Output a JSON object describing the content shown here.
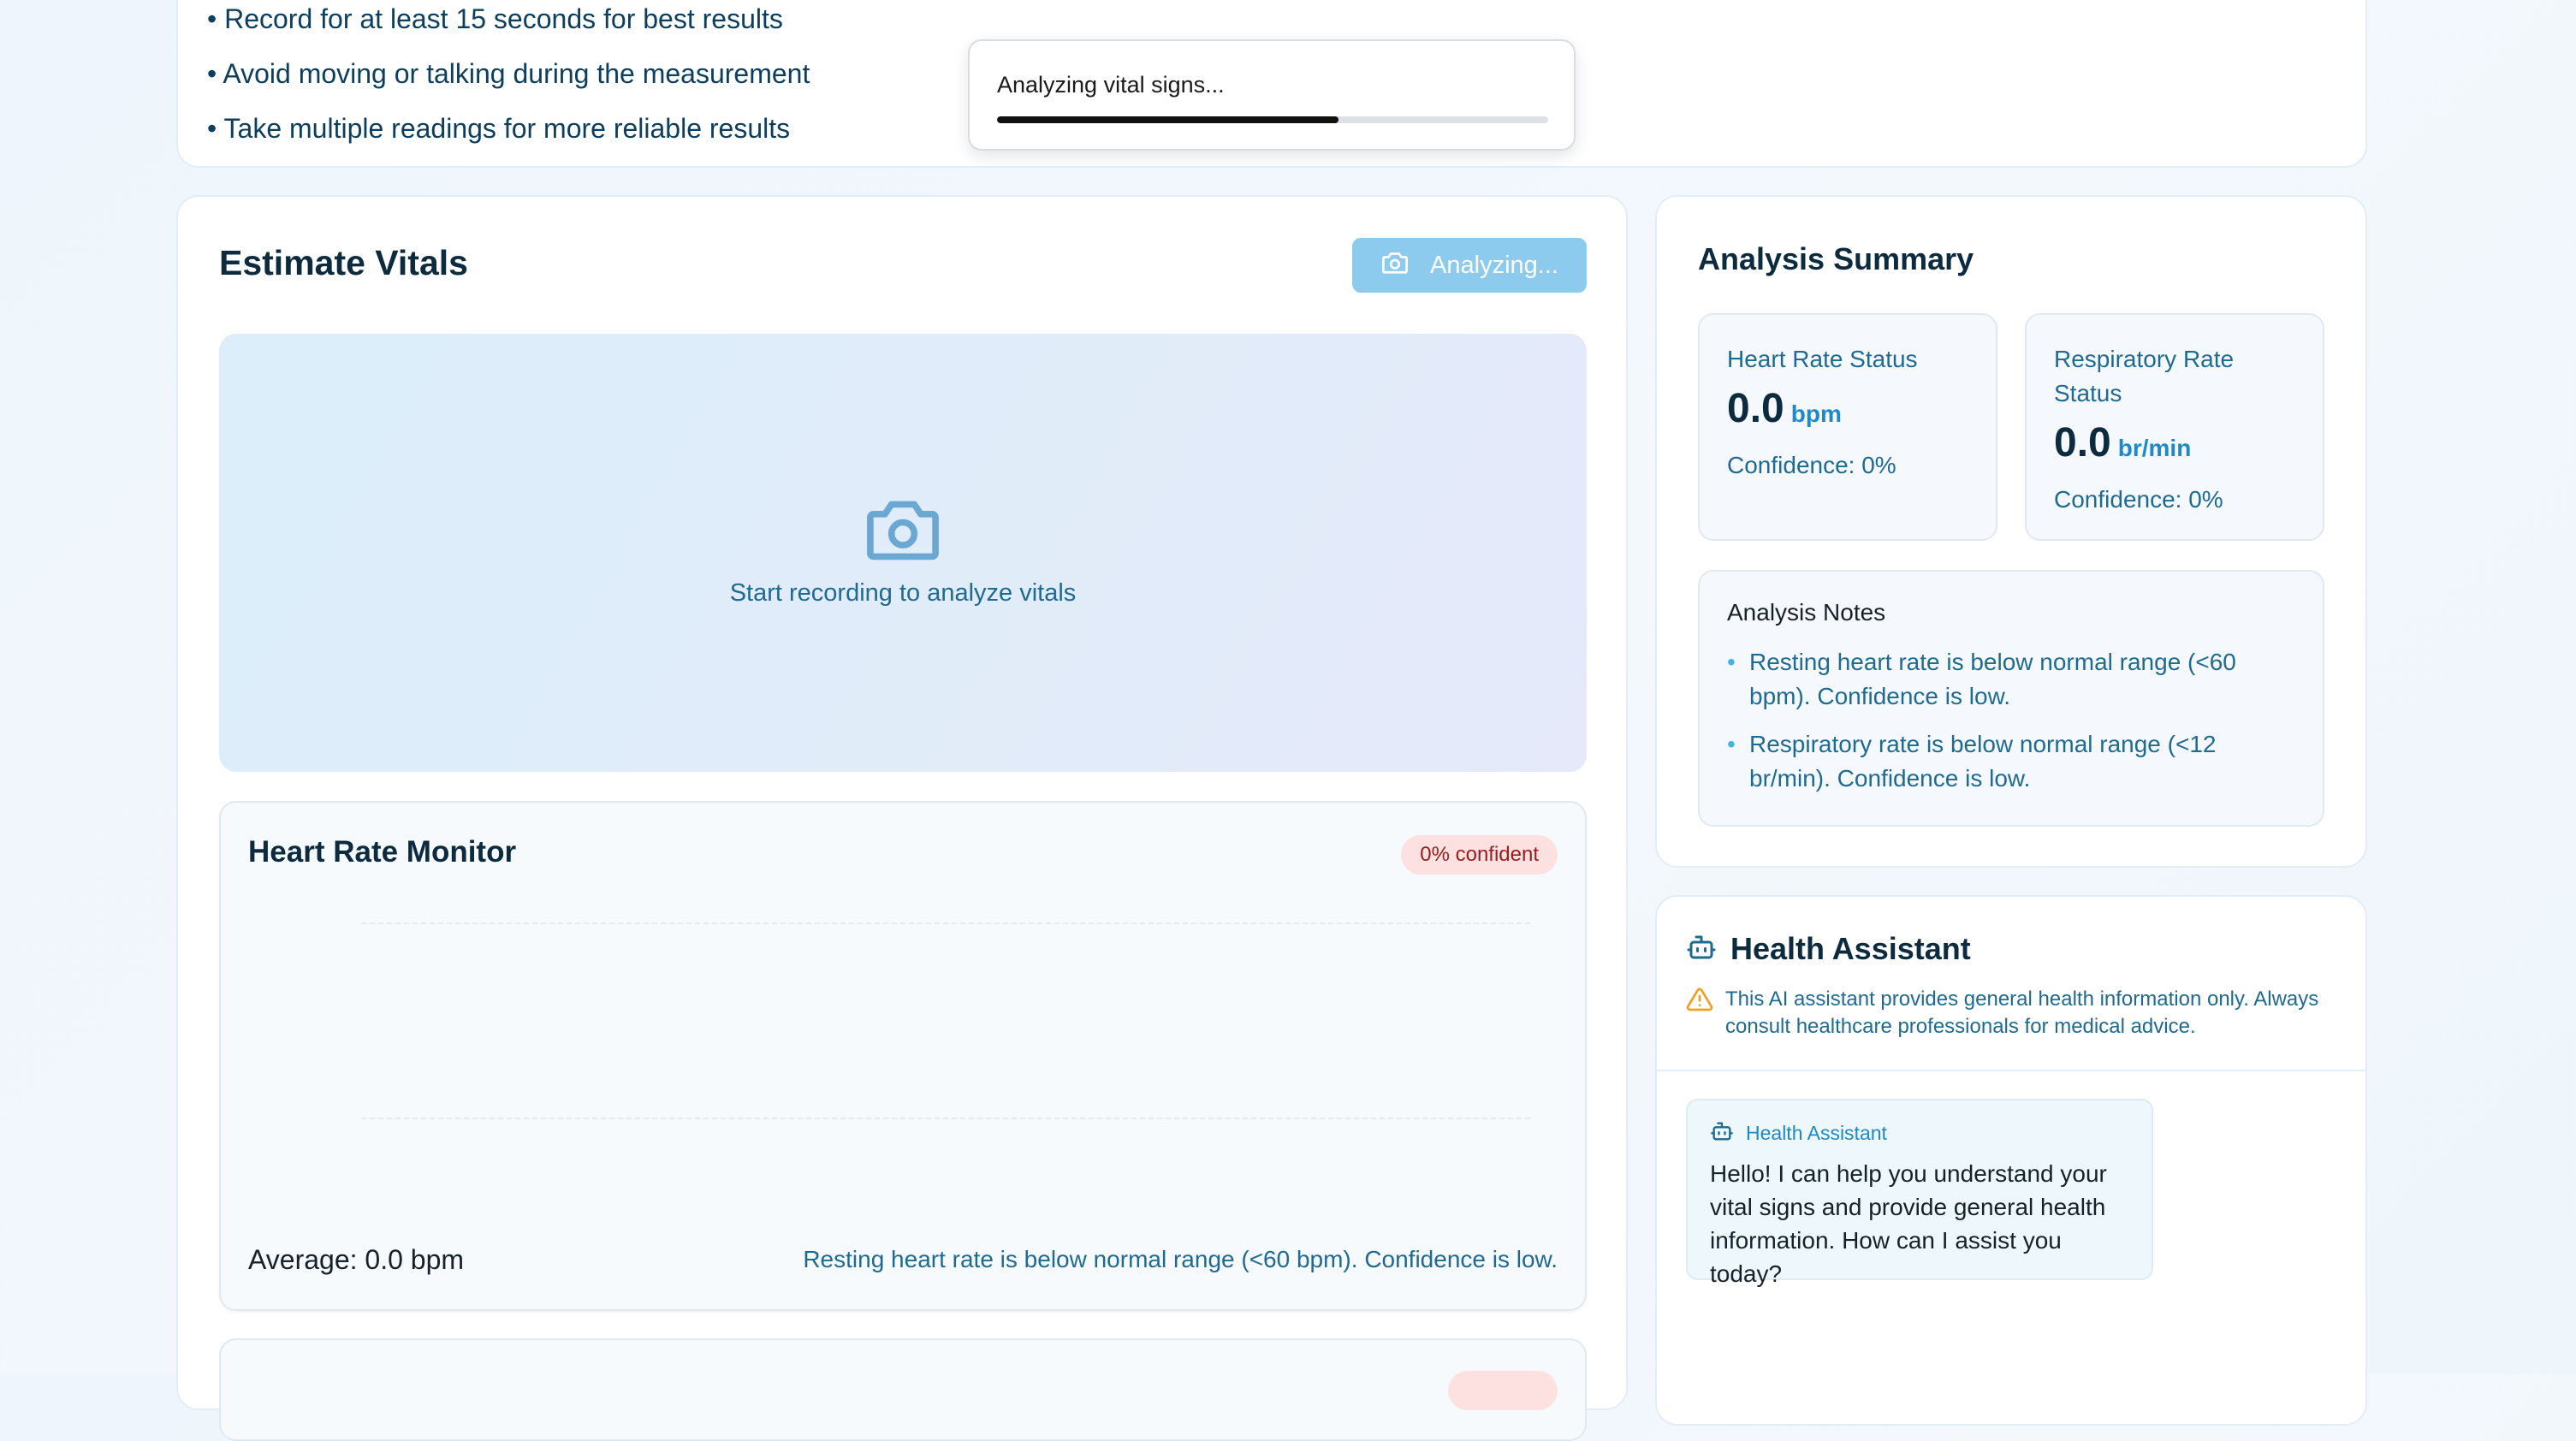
{
  "tips": {
    "items": [
      "Record for at least 15 seconds for best results",
      "Avoid moving or talking during the measurement",
      "Take multiple readings for more reliable results"
    ]
  },
  "toast": {
    "text": "Analyzing vital signs...",
    "progress_fraction": 0.62
  },
  "estimate": {
    "title": "Estimate Vitals",
    "analyze_button_label": "Analyzing...",
    "video_placeholder": "Start recording to analyze vitals"
  },
  "heart_rate_monitor": {
    "title": "Heart Rate Monitor",
    "confidence_badge": "0% confident",
    "average": "Average: 0.0 bpm",
    "note": "Resting heart rate is below normal range (<60 bpm). Confidence is low."
  },
  "summary": {
    "title": "Analysis Summary",
    "heart_rate": {
      "label": "Heart Rate Status",
      "value": "0.0",
      "unit": "bpm",
      "confidence": "Confidence: 0%"
    },
    "respiratory_rate": {
      "label": "Respiratory Rate Status",
      "value": "0.0",
      "unit": "br/min",
      "confidence": "Confidence: 0%"
    },
    "notes_title": "Analysis Notes",
    "notes": [
      "Resting heart rate is below normal range (<60 bpm). Confidence is low.",
      "Respiratory rate is below normal range (<12 br/min). Confidence is low."
    ]
  },
  "assistant": {
    "title": "Health Assistant",
    "disclaimer": "This AI assistant provides general health information only. Always consult healthcare professionals for medical advice.",
    "message_sender": "Health Assistant",
    "message_text": "Hello! I can help you understand your vital signs and provide general health information. How can I assist you today?"
  },
  "icons": {
    "camera": "camera-icon",
    "bot": "bot-icon",
    "warning": "warning-icon"
  },
  "colors": {
    "primary": "#1e88c8",
    "button_disabled": "#8ccbed",
    "badge_bg": "#fde0e0",
    "badge_text": "#9b1c1c",
    "warning": "#f0a020"
  }
}
